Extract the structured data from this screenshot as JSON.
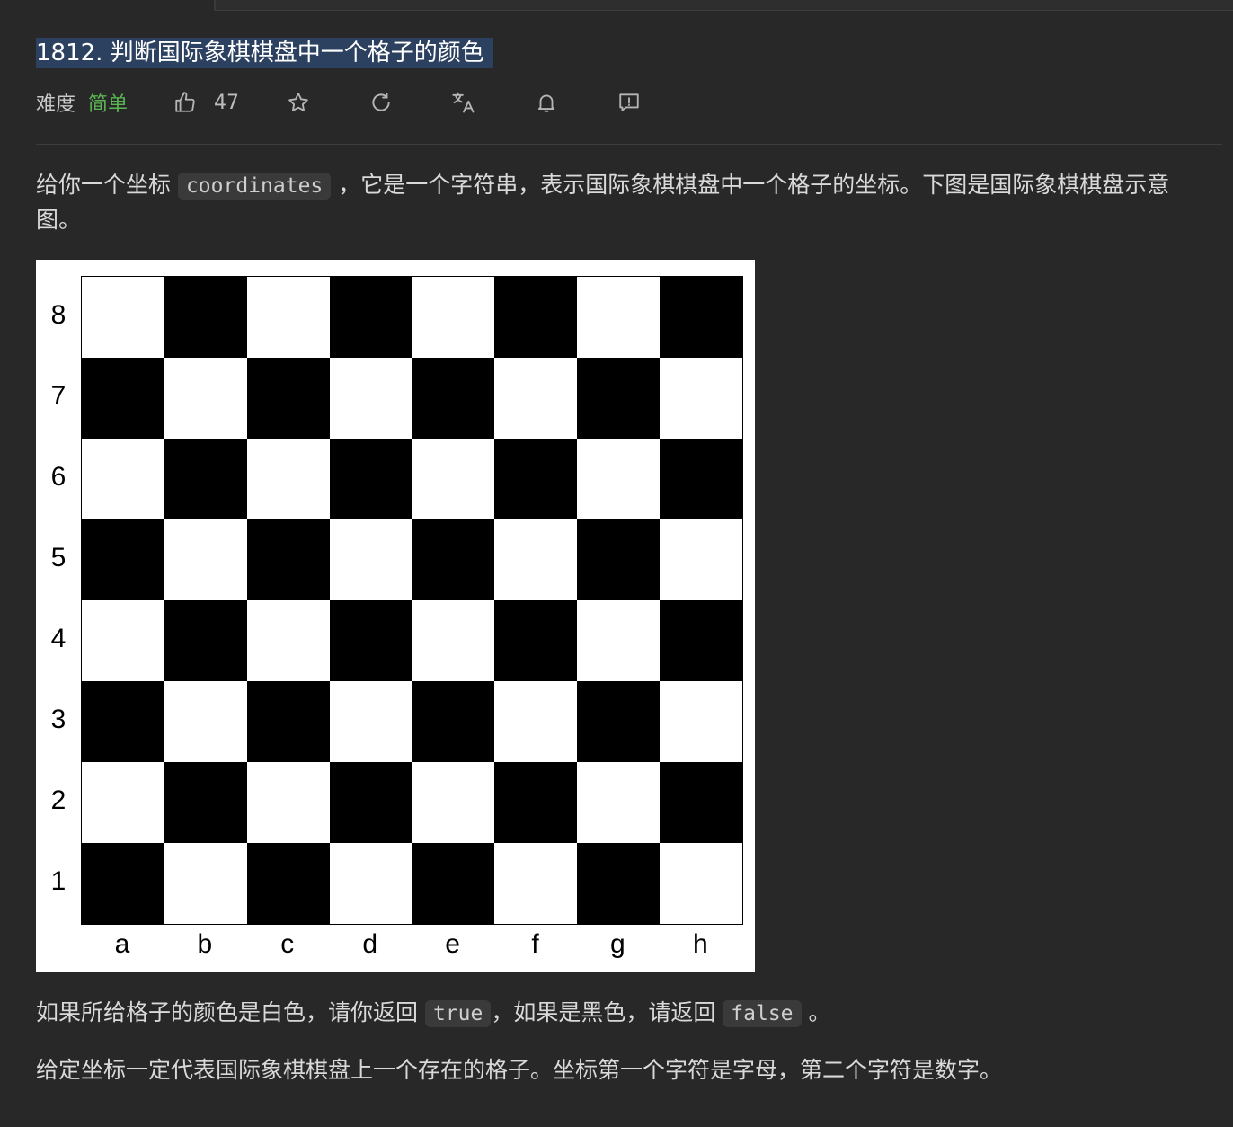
{
  "problem": {
    "title": "1812. 判断国际象棋棋盘中一个格子的颜色",
    "difficulty_label": "难度",
    "difficulty_value": "简单",
    "likes": "47"
  },
  "colors": {
    "easy": "#5ab552",
    "title_highlight": "#2c4060",
    "background": "#282828"
  },
  "icons": [
    "thumbs-up-icon",
    "star-icon",
    "refresh-icon",
    "translate-icon",
    "bell-icon",
    "feedback-icon"
  ],
  "description": {
    "p1_before": "给你一个坐标 ",
    "p1_code": "coordinates",
    "p1_after": " ，它是一个字符串，表示国际象棋棋盘中一个格子的坐标。下图是国际象棋棋盘示意",
    "p1_wrap": "图。",
    "p2_before": "如果所给格子的颜色是白色，请你返回 ",
    "p2_code1": "true",
    "p2_mid": "，如果是黑色，请返回 ",
    "p2_code2": "false",
    "p2_after": " 。",
    "p3": "给定坐标一定代表国际象棋棋盘上一个存在的格子。坐标第一个字符是字母，第二个字符是数字。"
  },
  "board": {
    "ranks": [
      "8",
      "7",
      "6",
      "5",
      "4",
      "3",
      "2",
      "1"
    ],
    "files": [
      "a",
      "b",
      "c",
      "d",
      "e",
      "f",
      "g",
      "h"
    ]
  }
}
